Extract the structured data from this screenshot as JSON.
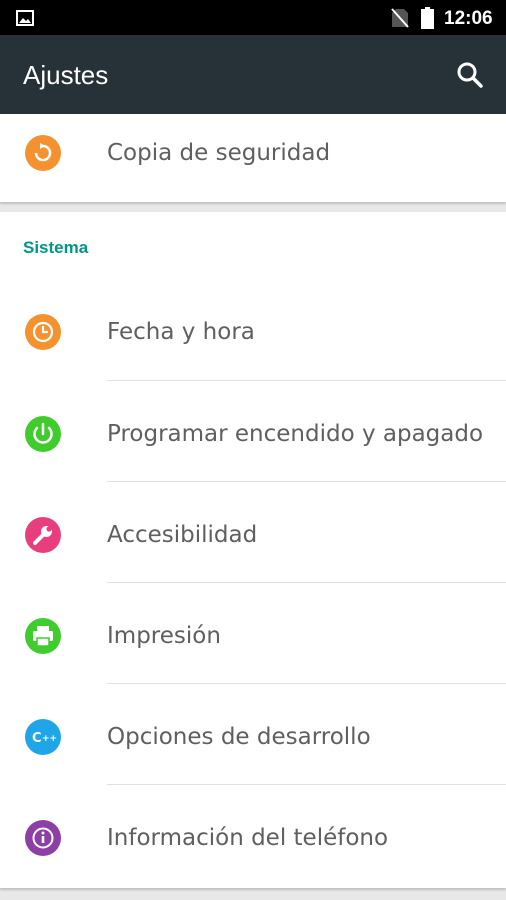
{
  "status_bar": {
    "time": "12:06",
    "icons": [
      "gallery-icon",
      "no-sim-icon",
      "battery-icon"
    ]
  },
  "app_bar": {
    "title": "Ajustes",
    "search_icon": "search-icon"
  },
  "top_items": [
    {
      "label": "Copia de seguridad",
      "icon": "backup-icon",
      "color": "#f3922f"
    }
  ],
  "system_section": {
    "header": "Sistema",
    "header_color": "#009688",
    "items": [
      {
        "label": "Fecha y hora",
        "icon": "clock-icon",
        "color": "#f3922f"
      },
      {
        "label": "Programar encendido y apagado",
        "icon": "power-icon",
        "color": "#3fcc2c"
      },
      {
        "label": "Accesibilidad",
        "icon": "wrench-icon",
        "color": "#e83e7e"
      },
      {
        "label": "Impresión",
        "icon": "printer-icon",
        "color": "#3fcc2c"
      },
      {
        "label": "Opciones de desarrollo",
        "icon": "developer-icon",
        "color": "#1ea6e8"
      },
      {
        "label": "Información del teléfono",
        "icon": "info-icon",
        "color": "#8e3fa6"
      }
    ]
  },
  "colors": {
    "app_bar": "#263238",
    "status_bar": "#000000",
    "label_text": "#5f5f5f",
    "background": "#e8e8e8"
  }
}
